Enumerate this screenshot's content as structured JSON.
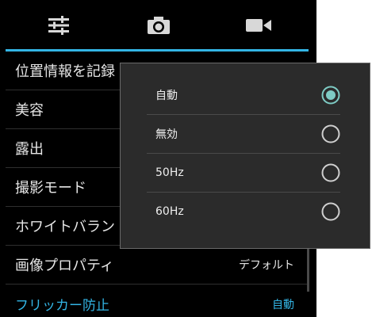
{
  "tabs": [
    {
      "icon": "sliders-icon",
      "selected": true
    },
    {
      "icon": "camera-icon",
      "selected": false
    },
    {
      "icon": "video-camera-icon",
      "selected": false
    }
  ],
  "settings": {
    "rows": [
      {
        "label": "位置情報を記録",
        "value": ""
      },
      {
        "label": "美容",
        "value": ""
      },
      {
        "label": "露出",
        "value": ""
      },
      {
        "label": "撮影モード",
        "value": ""
      },
      {
        "label": "ホワイトバラン",
        "value": ""
      },
      {
        "label": "画像プロパティ",
        "value": "デフォルト"
      },
      {
        "label": "フリッカー防止",
        "value": "自動"
      }
    ]
  },
  "popup": {
    "options": [
      {
        "label": "自動",
        "selected": true
      },
      {
        "label": "無効",
        "selected": false
      },
      {
        "label": "50Hz",
        "selected": false
      },
      {
        "label": "60Hz",
        "selected": false
      }
    ]
  },
  "colors": {
    "accent": "#33b5e5",
    "radio_selected": "#7ecbc4",
    "background": "#000000",
    "popup_background": "#2b2b2b"
  }
}
